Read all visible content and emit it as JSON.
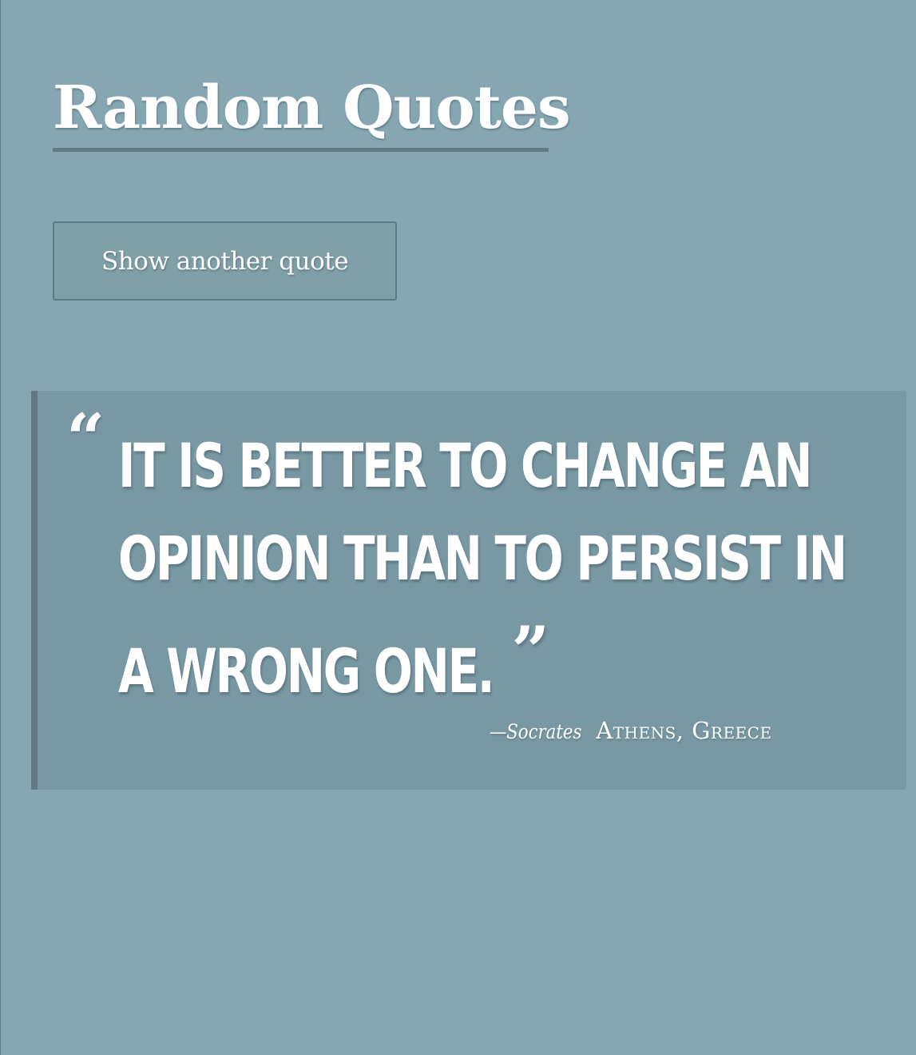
{
  "header": {
    "title": "Random Quotes"
  },
  "controls": {
    "new_quote_label": "Show another quote"
  },
  "quote": {
    "open_mark": "“",
    "close_mark": "”",
    "lines": [
      "It is better to change an",
      "opinion than to persist in",
      "a wrong one."
    ],
    "author": "—Socrates",
    "location": "Athens, Greece"
  },
  "colors": {
    "background": "#86a7b2",
    "card": "#7898a3",
    "accent": "#5f7a83",
    "text": "#ffffff"
  }
}
